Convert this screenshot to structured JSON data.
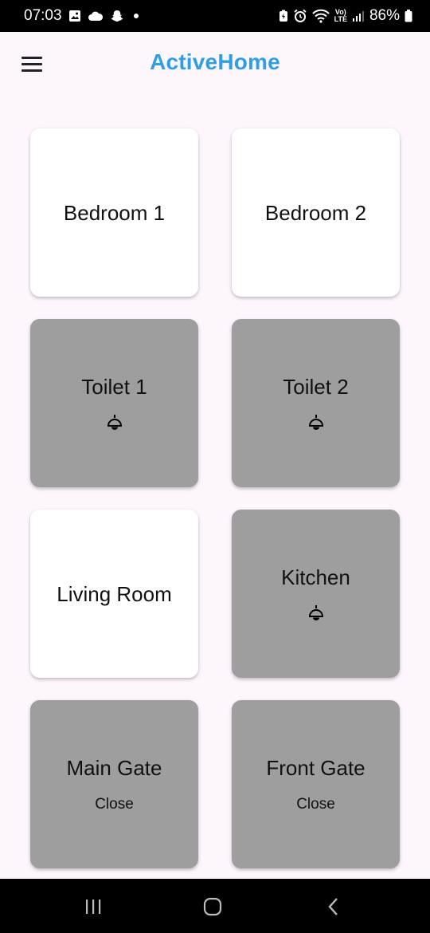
{
  "status_bar": {
    "time": "07:03",
    "battery_percent": "86%",
    "network_label_top": "Vo)",
    "network_label_bottom": "LTE"
  },
  "app_bar": {
    "title": "ActiveHome",
    "title_color": "#2f9ee4",
    "menu_icon": "menu-icon"
  },
  "rooms": [
    {
      "name": "Bedroom 1",
      "state": "on"
    },
    {
      "name": "Bedroom 2",
      "state": "on"
    },
    {
      "name": "Toilet 1",
      "state": "off",
      "icon": "ceiling-lamp-icon"
    },
    {
      "name": "Toilet 2",
      "state": "off",
      "icon": "ceiling-lamp-icon"
    },
    {
      "name": "Living Room",
      "state": "on"
    },
    {
      "name": "Kitchen",
      "state": "off",
      "icon": "ceiling-lamp-icon"
    },
    {
      "name": "Main Gate",
      "state": "off",
      "status": "Close"
    },
    {
      "name": "Front Gate",
      "state": "off",
      "status": "Close"
    }
  ],
  "colors": {
    "card_on": "#ffffff",
    "card_off": "#9e9e9e",
    "background": "#fdf6fd"
  },
  "nav_bar": {
    "recents_icon": "recents-icon",
    "home_icon": "home-icon",
    "back_icon": "back-icon"
  }
}
